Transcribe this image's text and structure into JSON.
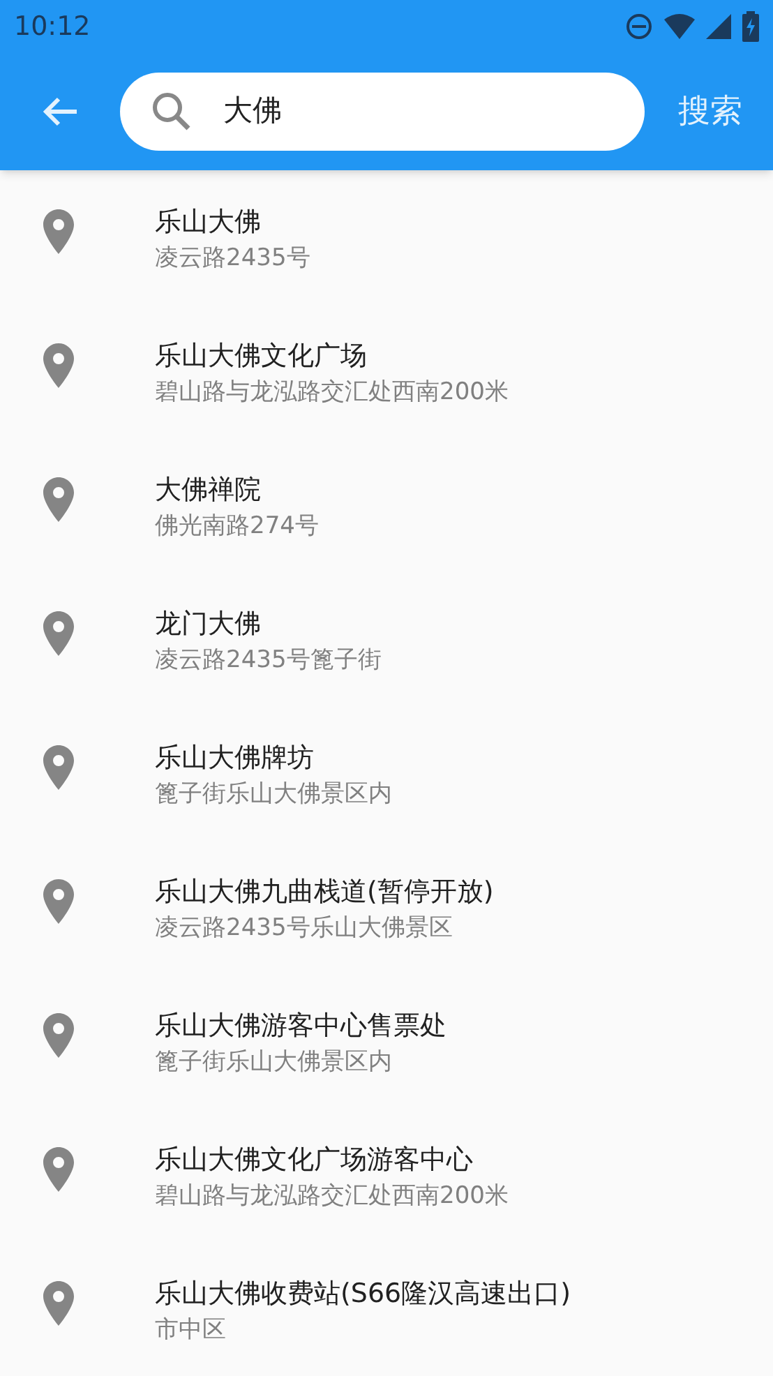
{
  "status_bar": {
    "time": "10:12"
  },
  "search": {
    "value": "大佛",
    "button": "搜索"
  },
  "results": [
    {
      "name": "乐山大佛",
      "address": "凌云路2435号"
    },
    {
      "name": "乐山大佛文化广场",
      "address": "碧山路与龙泓路交汇处西南200米"
    },
    {
      "name": "大佛禅院",
      "address": "佛光南路274号"
    },
    {
      "name": "龙门大佛",
      "address": "凌云路2435号篦子街"
    },
    {
      "name": "乐山大佛牌坊",
      "address": "篦子街乐山大佛景区内"
    },
    {
      "name": "乐山大佛九曲栈道(暂停开放)",
      "address": "凌云路2435号乐山大佛景区"
    },
    {
      "name": "乐山大佛游客中心售票处",
      "address": "篦子街乐山大佛景区内"
    },
    {
      "name": "乐山大佛文化广场游客中心",
      "address": "碧山路与龙泓路交汇处西南200米"
    },
    {
      "name": "乐山大佛收费站(S66隆汉高速出口)",
      "address": "市中区"
    }
  ]
}
